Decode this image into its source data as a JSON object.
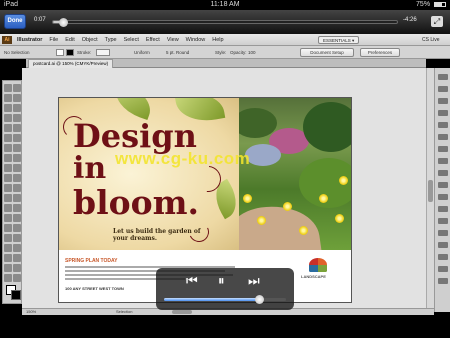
{
  "status_bar": {
    "device": "iPad",
    "clock": "11:18 AM",
    "battery_text": "75%"
  },
  "video_player": {
    "done_label": "Done",
    "elapsed": "0:07",
    "remaining": "-4:26",
    "progress_fraction": 0.03,
    "volume_fraction": 0.78
  },
  "app": {
    "logo_text": "Ai",
    "menu": [
      "Illustrator",
      "File",
      "Edit",
      "Object",
      "Type",
      "Select",
      "Effect",
      "View",
      "Window",
      "Help"
    ],
    "workspace": "ESSENTIALS ▾",
    "cs_live": "CS Live"
  },
  "control_bar": {
    "selection": "No Selection",
    "stroke_label": "Stroke:",
    "uniform": "Uniform",
    "pt_round": "5 pt. Round",
    "style_label": "Style:",
    "opacity_label": "Opacity:",
    "opacity_value": "100",
    "doc_setup": "Document Setup",
    "preferences": "Preferences"
  },
  "document": {
    "tab_label": "postcard.ai @ 150% (CMYK/Preview)",
    "zoom": "150%",
    "tool_status": "Selection"
  },
  "artwork": {
    "title_line1": "Design",
    "title_line2": "in",
    "title_line3": "bloom.",
    "tagline": "Let us build the garden of your dreams.",
    "headline": "SPRING PLAN TODAY",
    "contact": "100 ANY STREET WEST TOWN",
    "logo_text": "LANDSCAPE",
    "watermark": "www.cg-ku.com"
  }
}
